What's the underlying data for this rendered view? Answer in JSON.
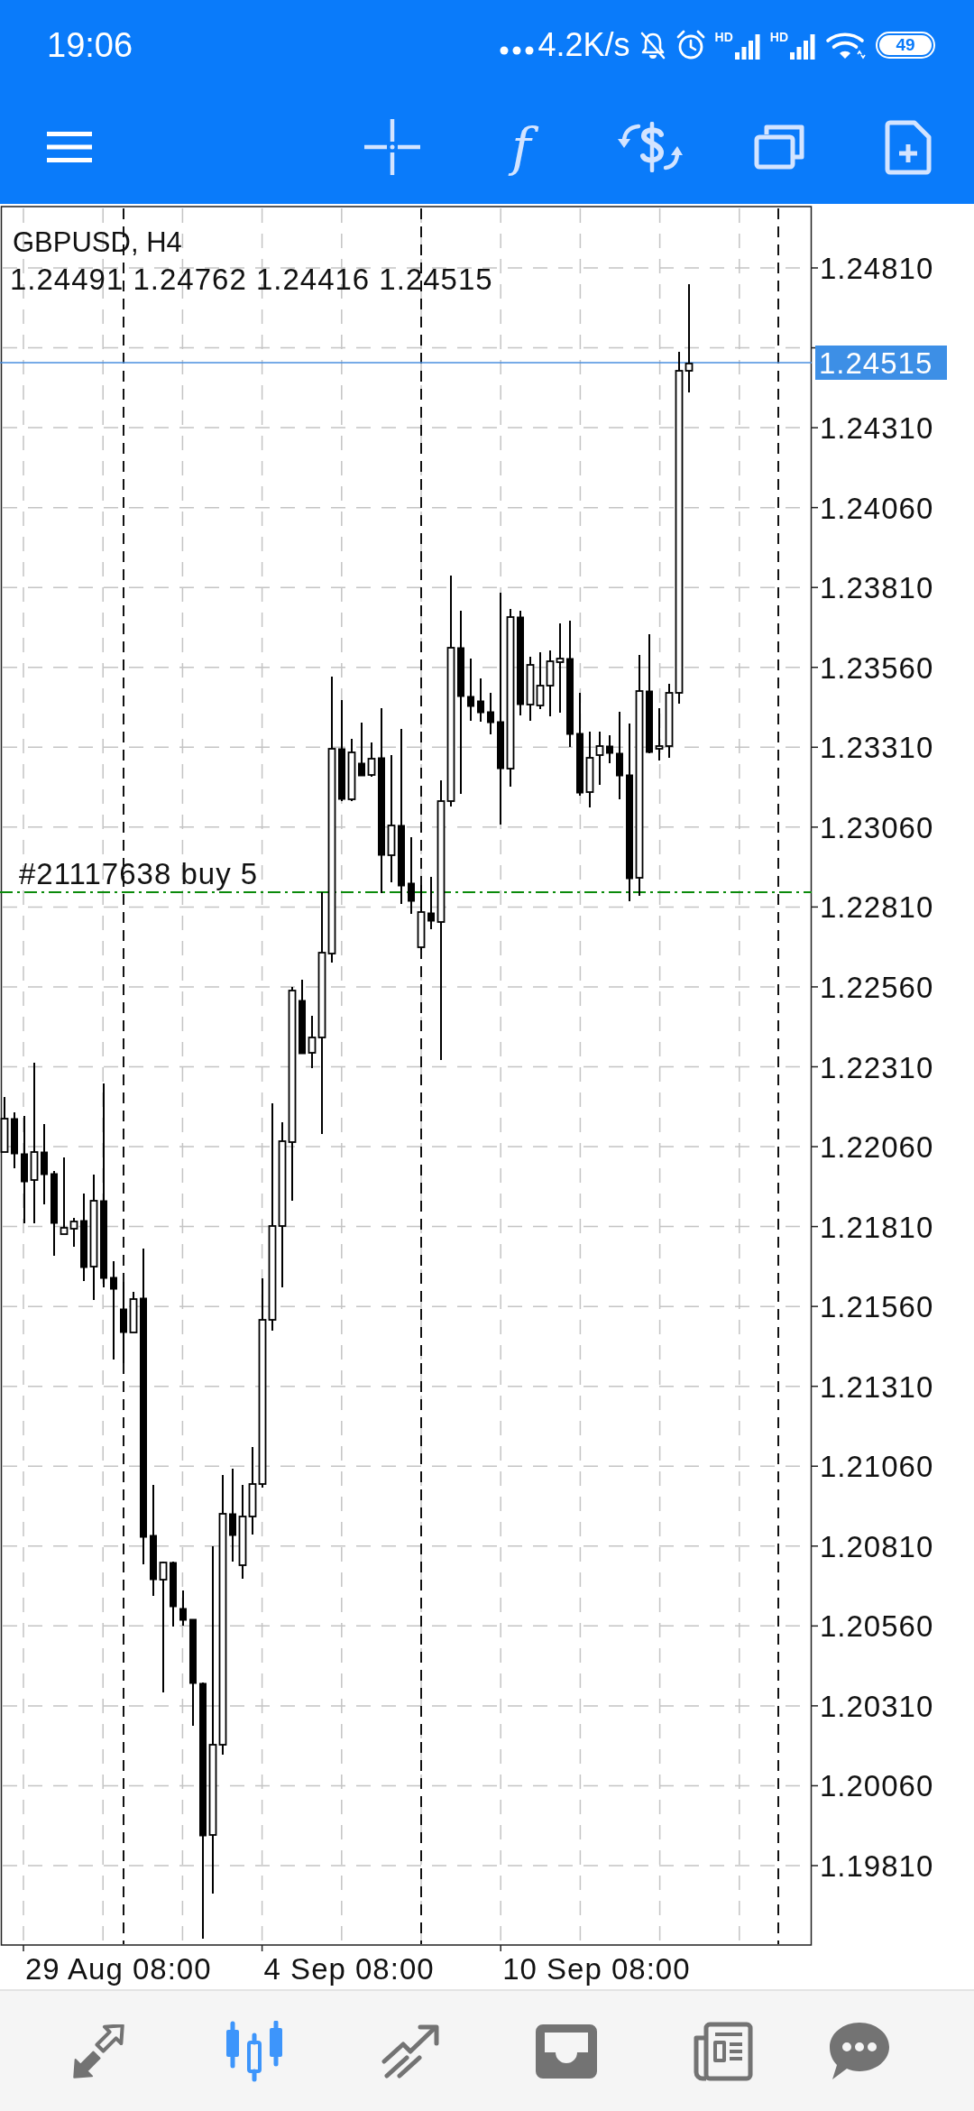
{
  "status_bar": {
    "time": "19:06",
    "network_speed": "4.2K/s",
    "signals": [
      {
        "label": "HD"
      },
      {
        "label": "HD"
      }
    ],
    "battery": "49"
  },
  "toolbar": [
    {
      "kind": "menu"
    },
    {
      "kind": "crosshair"
    },
    {
      "kind": "function",
      "label": "f"
    },
    {
      "kind": "exchange"
    },
    {
      "kind": "windows"
    },
    {
      "kind": "new_document"
    }
  ],
  "chart": {
    "symbol": "GBPUSD, H4",
    "ohlc": "1.24491 1.24762 1.24416 1.24515",
    "order_line": {
      "label": "#21117638 buy 5"
    },
    "price_axis": {
      "labels_above": [
        "1.24810"
      ],
      "current_price": "1.24515",
      "labels_below": [
        "1.24310",
        "1.24060",
        "1.23810",
        "1.23560",
        "1.23310",
        "1.23060",
        "1.22810",
        "1.22560",
        "1.22310",
        "1.22060",
        "1.21810",
        "1.21560",
        "1.21310",
        "1.21060",
        "1.20810",
        "1.20560",
        "1.20310",
        "1.20060",
        "1.19810"
      ]
    },
    "time_axis": [
      "29 Aug 08:00",
      "4 Sep 08:00",
      "10 Sep 08:00"
    ]
  },
  "bottom_nav": [
    {
      "kind": "arrows",
      "selected": false
    },
    {
      "kind": "candles",
      "selected": true
    },
    {
      "kind": "trend",
      "selected": false
    },
    {
      "kind": "inbox",
      "selected": false
    },
    {
      "kind": "newspaper",
      "selected": false
    },
    {
      "kind": "chat",
      "selected": false
    }
  ]
}
